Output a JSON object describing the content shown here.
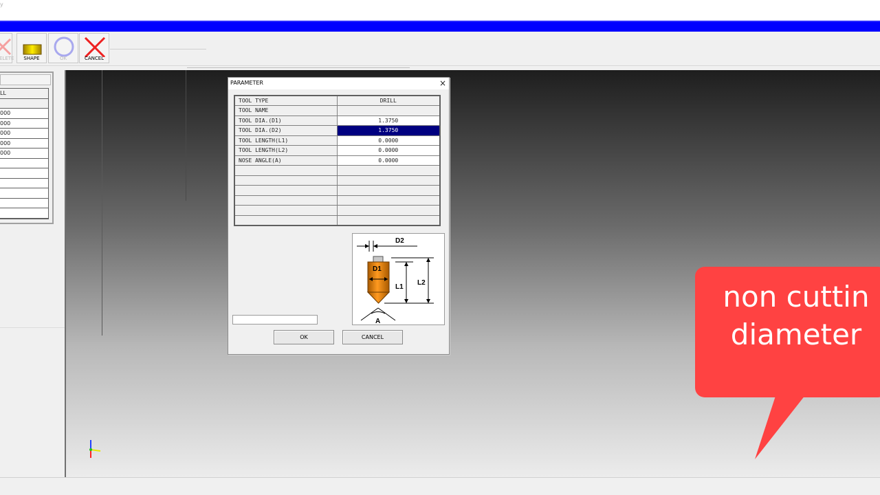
{
  "window": {
    "title": "y"
  },
  "toolbar": {
    "buttons": [
      {
        "label": "ELETE",
        "icon": "delete-x-icon",
        "enabled": false
      },
      {
        "label": "SHAPE",
        "icon": "shape-icon",
        "enabled": true
      },
      {
        "label": "OK",
        "icon": "ok-circle-icon",
        "enabled": false
      },
      {
        "label": "CANCEL",
        "icon": "cancel-x-icon",
        "enabled": true
      }
    ]
  },
  "left_panel": {
    "rows": [
      "LL",
      "",
      "000",
      "000",
      "000",
      "000",
      "000",
      "",
      "",
      "",
      "",
      "",
      ""
    ]
  },
  "dialog": {
    "title": "PARAMETER",
    "close": "×",
    "table": {
      "rows": [
        {
          "label": "TOOL TYPE",
          "value": "DRILL"
        },
        {
          "label": "TOOL NAME",
          "value": ""
        },
        {
          "label": "TOOL DIA.(D1)",
          "value": "1.3750"
        },
        {
          "label": "TOOL DIA.(D2)",
          "value": "1.3750",
          "selected": true
        },
        {
          "label": "TOOL LENGTH(L1)",
          "value": "0.0000"
        },
        {
          "label": "TOOL LENGTH(L2)",
          "value": "0.0000"
        },
        {
          "label": "NOSE ANGLE(A)",
          "value": "0.0000"
        }
      ]
    },
    "diagram_labels": {
      "d2": "D2",
      "d1": "D1",
      "l1": "L1",
      "l2": "L2",
      "a": "A"
    },
    "status_text": "",
    "ok_label": "OK",
    "cancel_label": "CANCEL"
  },
  "callout": {
    "line1": "non cuttin",
    "line2": "diameter",
    "color": "#ff4242"
  },
  "colors": {
    "selection": "#000080",
    "title_blue": "#0000ff"
  }
}
